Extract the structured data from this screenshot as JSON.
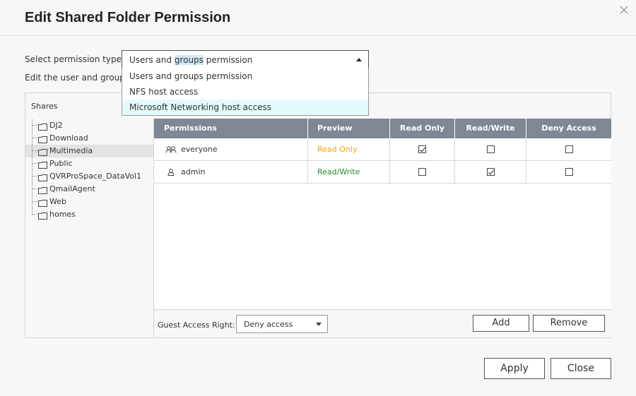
{
  "dialog": {
    "title": "Edit Shared Folder Permission",
    "close_icon": "close-icon"
  },
  "permission_type": {
    "label": "Select permission type:",
    "selected_pre": "Users and ",
    "selected_hl": "groups",
    "selected_post": " permission",
    "options": [
      "Users and groups permission",
      "NFS host access",
      "Microsoft Networking host access"
    ],
    "highlighted_index": 2
  },
  "edit_label": "Edit the user and group permission",
  "shares": {
    "header": "Shares",
    "items": [
      "DJ2",
      "Download",
      "Multimedia",
      "Public",
      "QVRProSpace_DataVol1",
      "QmailAgent",
      "Web",
      "homes"
    ],
    "selected_index": 2
  },
  "grid": {
    "columns": [
      "Permissions",
      "Preview",
      "Read Only",
      "Read/Write",
      "Deny Access"
    ],
    "rows": [
      {
        "name": "everyone",
        "icon": "group-icon",
        "preview": "Read Only",
        "read_only": true,
        "read_write": false,
        "deny": false
      },
      {
        "name": "admin",
        "icon": "user-icon",
        "preview": "Read/Write",
        "read_only": false,
        "read_write": true,
        "deny": false
      }
    ]
  },
  "guest": {
    "label": "Guest Access Right:",
    "value": "Deny access"
  },
  "buttons": {
    "add": "Add",
    "remove": "Remove",
    "apply": "Apply",
    "close": "Close"
  },
  "colors": {
    "grid_header": "#7f8694",
    "read_only_text": "#f0a30a",
    "read_write_text": "#2b8a2b",
    "dropdown_highlight": "#e4fafa"
  }
}
